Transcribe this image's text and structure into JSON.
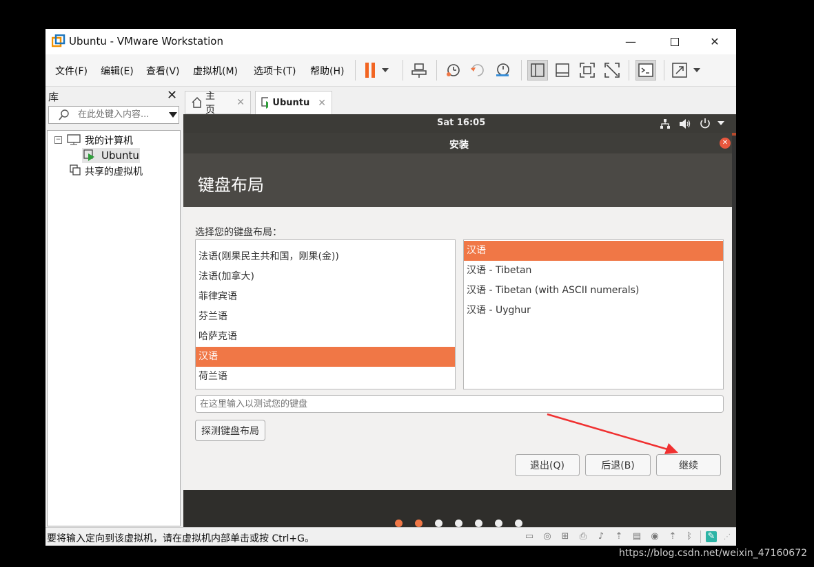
{
  "window": {
    "title": "Ubuntu - VMware Workstation"
  },
  "menu": [
    "文件(F)",
    "编辑(E)",
    "查看(V)",
    "虚拟机(M)",
    "选项卡(T)",
    "帮助(H)"
  ],
  "library": {
    "header": "库",
    "search_placeholder": "在此处键入内容...",
    "tree": {
      "my_computer": "我的计算机",
      "vm": "Ubuntu",
      "shared": "共享的虚拟机"
    }
  },
  "tabs": [
    {
      "label": "主页"
    },
    {
      "label": "Ubuntu"
    }
  ],
  "vm": {
    "clock": "Sat 16:05",
    "dialog_title": "安装",
    "heading": "键盘布局",
    "prompt": "选择您的键盘布局：",
    "layouts": [
      "法语(刚果民主共和国，刚果(金))",
      "法语(加拿大)",
      "菲律宾语",
      "芬兰语",
      "哈萨克语",
      "汉语",
      "荷兰语"
    ],
    "selected_layout": "汉语",
    "variants": [
      "汉语",
      "汉语 - Tibetan",
      "汉语 - Tibetan (with ASCII numerals)",
      "汉语 - Uyghur"
    ],
    "selected_variant": "汉语",
    "test_placeholder": "在这里输入以测试您的键盘",
    "detect_button": "探测键盘布局",
    "quit_button": "退出(Q)",
    "back_button": "后退(B)",
    "continue_button": "继续",
    "progress": {
      "total_steps": 7,
      "current_step": 2
    }
  },
  "status_bar": {
    "text": "要将输入定向到该虚拟机，请在虚拟机内部单击或按 Ctrl+G。"
  },
  "watermark": "https://blog.csdn.net/weixin_47160672",
  "colors": {
    "accent": "#f07746",
    "ubuntu_panel": "#3c3b37",
    "pause_orange": "#f26522",
    "annotation_arrow": "#f03030"
  }
}
